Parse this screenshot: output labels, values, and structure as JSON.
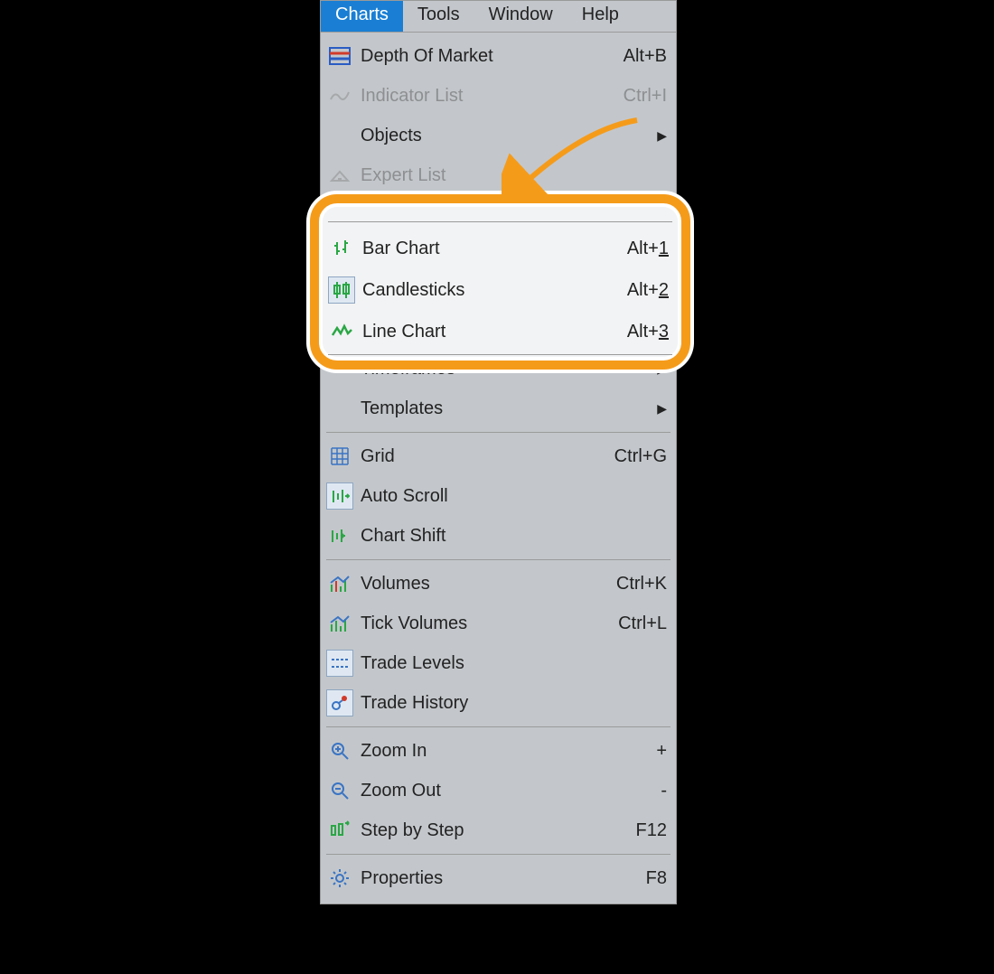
{
  "menubar": {
    "items": [
      "Charts",
      "Tools",
      "Window",
      "Help"
    ],
    "active_index": 0
  },
  "menu": {
    "section1": [
      {
        "key": "depth",
        "label": "Depth Of Market",
        "shortcut": "Alt+B",
        "iconColor": "#d23a2a",
        "disabled": false
      },
      {
        "key": "indicator",
        "label": "Indicator List",
        "shortcut": "Ctrl+I",
        "disabled": true
      },
      {
        "key": "objects",
        "label": "Objects",
        "submenu": true
      },
      {
        "key": "expert",
        "label": "Expert List",
        "disabled": true
      }
    ],
    "chart_types": [
      {
        "key": "bar",
        "label": "Bar Chart",
        "shortcut_prefix": "Alt+",
        "shortcut_num": "1"
      },
      {
        "key": "candle",
        "label": "Candlesticks",
        "shortcut_prefix": "Alt+",
        "shortcut_num": "2",
        "toggled": true
      },
      {
        "key": "line",
        "label": "Line Chart",
        "shortcut_prefix": "Alt+",
        "shortcut_num": "3"
      }
    ],
    "section3": [
      {
        "key": "timeframes",
        "label": "Timeframes",
        "submenu": true
      },
      {
        "key": "templates",
        "label": "Templates",
        "submenu": true
      }
    ],
    "section4": [
      {
        "key": "grid",
        "label": "Grid",
        "shortcut": "Ctrl+G"
      },
      {
        "key": "autoscroll",
        "label": "Auto Scroll",
        "toggled": true
      },
      {
        "key": "chartshift",
        "label": "Chart Shift"
      }
    ],
    "section5": [
      {
        "key": "volumes",
        "label": "Volumes",
        "shortcut": "Ctrl+K"
      },
      {
        "key": "tickvol",
        "label": "Tick Volumes",
        "shortcut": "Ctrl+L"
      },
      {
        "key": "tradelevels",
        "label": "Trade Levels",
        "toggled": true
      },
      {
        "key": "tradehist",
        "label": "Trade History",
        "toggled": true
      }
    ],
    "section6": [
      {
        "key": "zoomin",
        "label": "Zoom In",
        "shortcut": "+"
      },
      {
        "key": "zoomout",
        "label": "Zoom Out",
        "shortcut": "-"
      },
      {
        "key": "step",
        "label": "Step by Step",
        "shortcut": "F12"
      }
    ],
    "section7": [
      {
        "key": "props",
        "label": "Properties",
        "shortcut": "F8"
      }
    ]
  },
  "colors": {
    "accent": "#1a7fd4",
    "highlight": "#f59b1a",
    "green": "#2aa745",
    "blue_icon": "#3a74c4"
  }
}
